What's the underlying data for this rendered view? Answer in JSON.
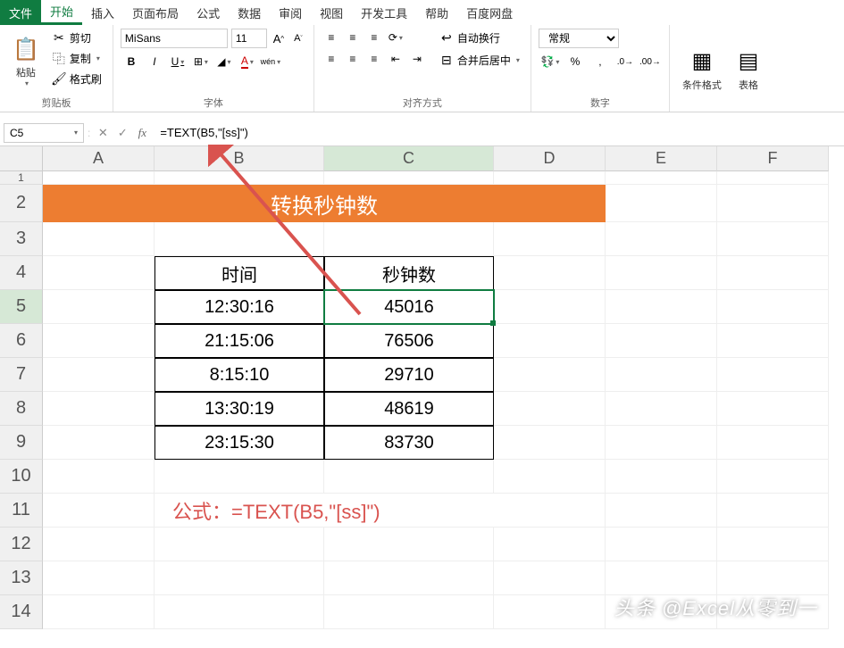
{
  "menu": {
    "file": "文件",
    "home": "开始",
    "insert": "插入",
    "pageLayout": "页面布局",
    "formulas": "公式",
    "data": "数据",
    "review": "审阅",
    "view": "视图",
    "developer": "开发工具",
    "help": "帮助",
    "baidu": "百度网盘"
  },
  "ribbon": {
    "clipboard": {
      "label": "剪贴板",
      "paste": "粘贴",
      "cut": "剪切",
      "copy": "复制",
      "formatPainter": "格式刷"
    },
    "font": {
      "label": "字体",
      "name": "MiSans",
      "size": "11",
      "wen": "wén"
    },
    "alignment": {
      "label": "对齐方式",
      "wrapText": "自动换行",
      "mergeCenter": "合并后居中"
    },
    "number": {
      "label": "数字",
      "format": "常规"
    },
    "styles": {
      "conditionalFormat": "条件格式",
      "formatTable": "表格"
    }
  },
  "nameBox": "C5",
  "formula": "=TEXT(B5,\"[ss]\")",
  "columns": [
    "A",
    "B",
    "C",
    "D",
    "E",
    "F"
  ],
  "rows": [
    "1",
    "2",
    "3",
    "4",
    "5",
    "6",
    "7",
    "8",
    "9",
    "10",
    "11",
    "12",
    "13",
    "14"
  ],
  "sheet": {
    "bannerTitle": "转换秒钟数",
    "headerB": "时间",
    "headerC": "秒钟数",
    "data": [
      {
        "time": "12:30:16",
        "seconds": "45016"
      },
      {
        "time": "21:15:06",
        "seconds": "76506"
      },
      {
        "time": "8:15:10",
        "seconds": "29710"
      },
      {
        "time": "13:30:19",
        "seconds": "48619"
      },
      {
        "time": "23:15:30",
        "seconds": "83730"
      }
    ],
    "formulaNote": "公式：=TEXT(B5,\"[ss]\")"
  },
  "watermark": "头条 @Excel从零到一"
}
